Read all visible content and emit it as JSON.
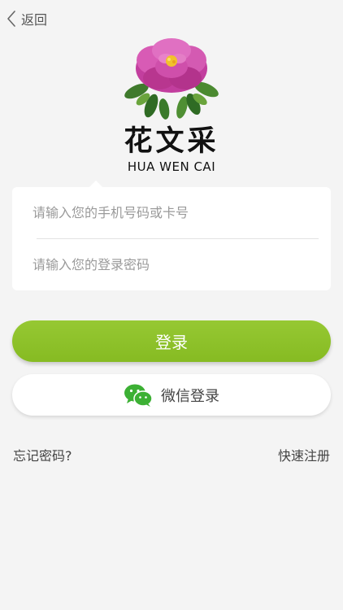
{
  "nav": {
    "back_label": "返回",
    "back_icon": "chevron-left-icon"
  },
  "logo": {
    "title_cn": "花文采",
    "title_en": "HUA WEN CAI",
    "image_icon": "peony-flower-icon"
  },
  "form": {
    "phone_placeholder": "请输入您的手机号码或卡号",
    "password_placeholder": "请输入您的登录密码"
  },
  "actions": {
    "login_label": "登录",
    "wechat_label": "微信登录",
    "wechat_icon": "wechat-icon"
  },
  "links": {
    "forgot_password": "忘记密码?",
    "register": "快速注册"
  },
  "colors": {
    "accent_green": "#8cc12a",
    "wechat_green": "#3cb034",
    "background": "#f4f4f4"
  }
}
